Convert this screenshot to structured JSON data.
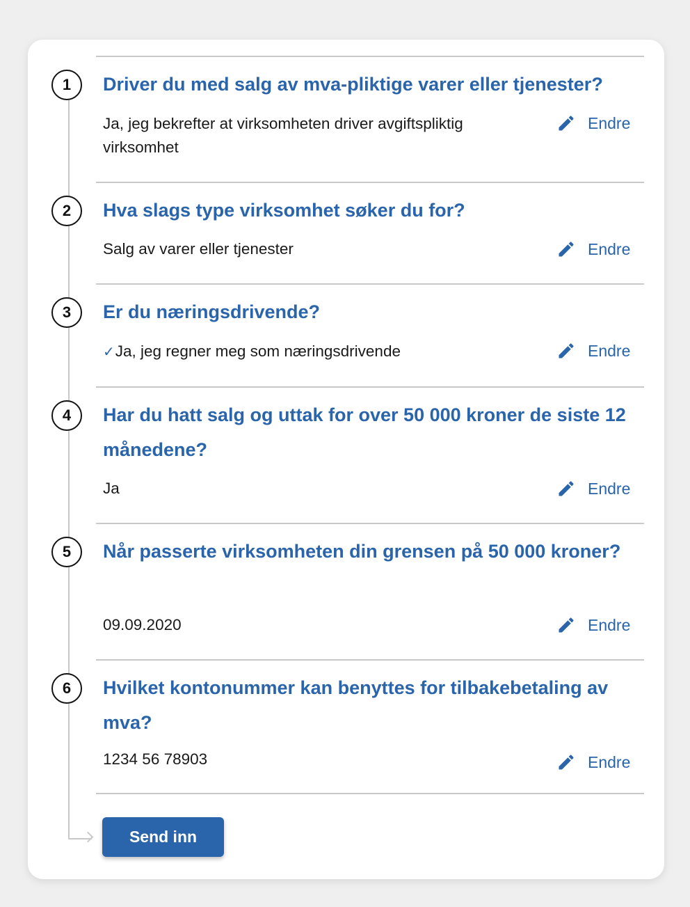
{
  "steps": [
    {
      "number": "1",
      "question": "Driver du med salg av mva-pliktige varer eller tjenester?",
      "answer": "Ja, jeg bekrefter at virksomheten driver avgiftspliktig virksomhet",
      "edit_label": "Endre"
    },
    {
      "number": "2",
      "question": "Hva slags type virksomhet søker du for?",
      "answer": "Salg av varer eller tjenester",
      "edit_label": "Endre"
    },
    {
      "number": "3",
      "question": "Er du næringsdrivende?",
      "answer": "Ja, jeg regner meg som næringsdrivende",
      "answer_icon": "checkmark-icon",
      "edit_label": "Endre"
    },
    {
      "number": "4",
      "question": "Har du hatt salg og uttak for over 50 000 kroner de siste 12 månedene?",
      "answer": "Ja",
      "edit_label": "Endre"
    },
    {
      "number": "5",
      "question": "Når passerte virksomheten din grensen på 50 000 kroner?",
      "answer": "09.09.2020",
      "edit_label": "Endre"
    },
    {
      "number": "6",
      "question": "Hvilket kontonummer kan benyttes for tilbakebetaling av mva?",
      "answer": "1234 56 78903",
      "edit_label": "Endre"
    }
  ],
  "submit_label": "Send inn",
  "colors": {
    "accent": "#2a64ab",
    "text": "#1a1a1a",
    "divider": "#c8c8c8",
    "background": "#efefef"
  },
  "icons": {
    "edit": "pencil-icon",
    "check": "checkmark-icon",
    "flow_arrow": "arrow-right-icon"
  }
}
